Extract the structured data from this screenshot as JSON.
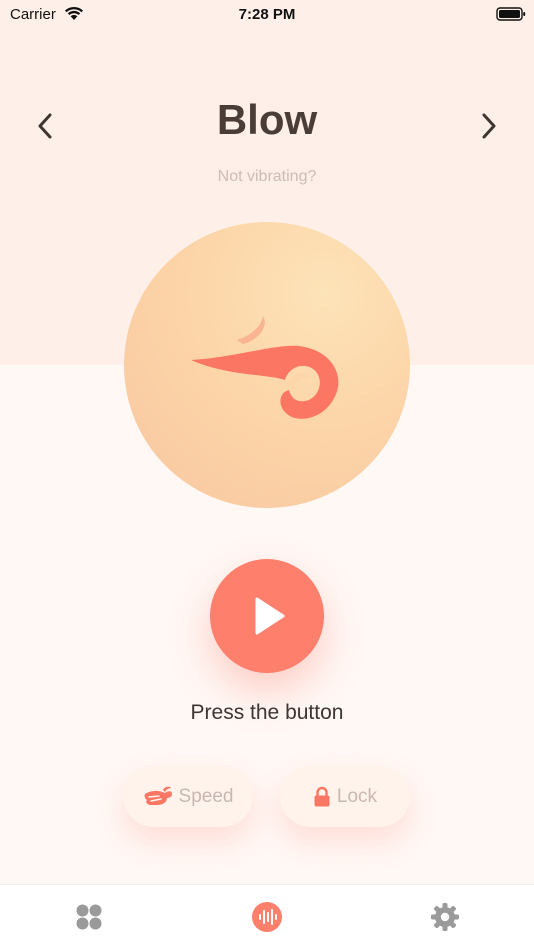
{
  "status_bar": {
    "carrier": "Carrier",
    "time": "7:28 PM"
  },
  "header": {
    "title": "Blow",
    "help_link": "Not vibrating?",
    "prev_icon": "chevron-left-icon",
    "next_icon": "chevron-right-icon"
  },
  "hero": {
    "icon": "blow-wind-icon"
  },
  "controls": {
    "play_icon": "play-icon",
    "press_label": "Press the button",
    "speed_label": "Speed",
    "speed_icon": "rabbit-icon",
    "lock_label": "Lock",
    "lock_icon": "lock-icon"
  },
  "tab_bar": {
    "tabs": [
      {
        "icon": "grid-icon",
        "active": false
      },
      {
        "icon": "sound-wave-icon",
        "active": true
      },
      {
        "icon": "gear-icon",
        "active": false
      }
    ]
  },
  "colors": {
    "accent": "#fd7f6c",
    "title": "#4a3c36",
    "top_band": "#fef0e8",
    "background": "#fff8f5",
    "circle": "#fcd5a8",
    "muted_text": "#c9bdb6",
    "tab_icon": "#9a9a9a"
  }
}
